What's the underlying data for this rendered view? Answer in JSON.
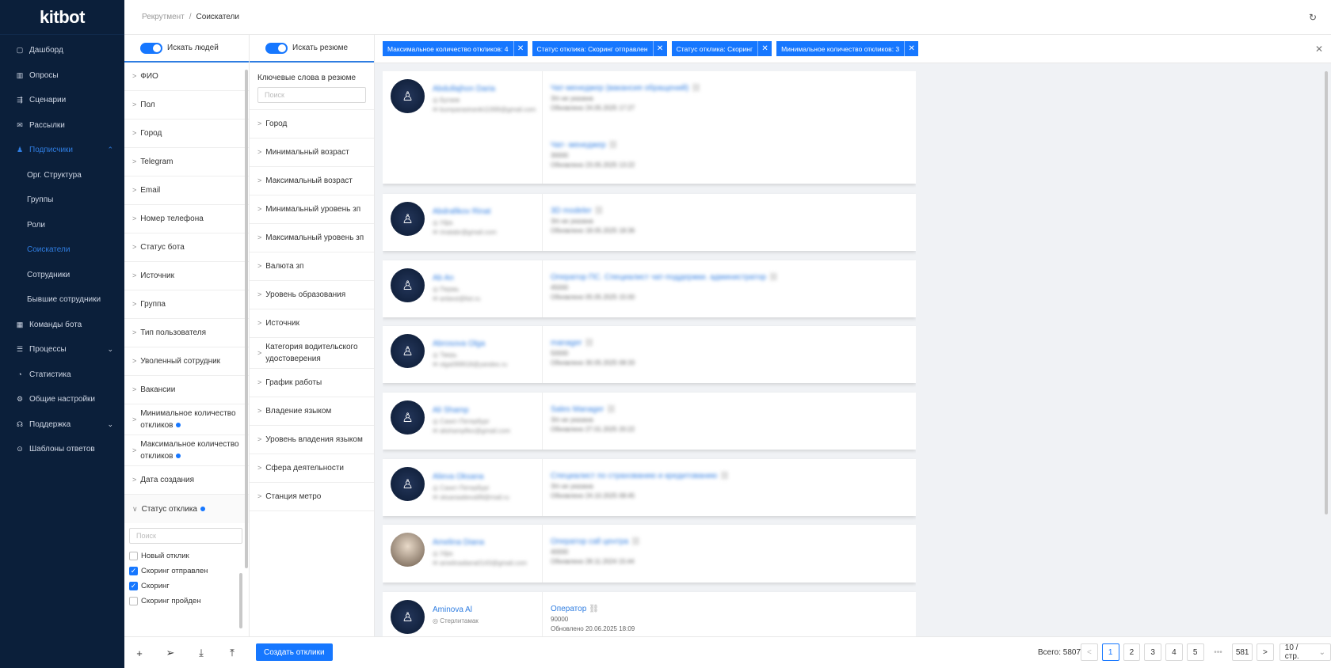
{
  "sidebar": {
    "logo": "kitbot",
    "items": [
      {
        "label": "Дашборд",
        "icon": "dashboard-icon",
        "glyph": "▢"
      },
      {
        "label": "Опросы",
        "icon": "chart-icon",
        "glyph": "▥"
      },
      {
        "label": "Сценарии",
        "icon": "scenario-icon",
        "glyph": "⇶"
      },
      {
        "label": "Рассылки",
        "icon": "mail-icon",
        "glyph": "✉"
      },
      {
        "label": "Подписчики",
        "icon": "users-icon",
        "glyph": "♟",
        "chevron": "⌃"
      },
      {
        "label": "Орг. Структура",
        "sub": true
      },
      {
        "label": "Группы",
        "sub": true
      },
      {
        "label": "Роли",
        "sub": true
      },
      {
        "label": "Соискатели",
        "sub": true
      },
      {
        "label": "Сотрудники",
        "sub": true
      },
      {
        "label": "Бывшие сотрудники",
        "sub": true
      },
      {
        "label": "Команды бота",
        "icon": "grid-icon",
        "glyph": "▦"
      },
      {
        "label": "Процессы",
        "icon": "list-icon",
        "glyph": "☰",
        "chevron": "⌄"
      },
      {
        "label": "Статистика",
        "icon": "pie-icon",
        "glyph": "◔"
      },
      {
        "label": "Общие настройки",
        "icon": "gear-icon",
        "glyph": "⚙"
      },
      {
        "label": "Поддержка",
        "icon": "headset-icon",
        "glyph": "☊",
        "chevron": "⌄"
      },
      {
        "label": "Шаблоны ответов",
        "icon": "template-icon",
        "glyph": "⊙"
      }
    ]
  },
  "header": {
    "crumb_prev": "Рекрутмент",
    "crumb_sep": "/",
    "crumb_cur": "Соискатели",
    "refresh_glyph": "↻"
  },
  "filters_people": {
    "toggle_label": "Искать людей",
    "arrow": ">",
    "dot_active": true,
    "items": [
      {
        "label": "ФИО"
      },
      {
        "label": "Пол"
      },
      {
        "label": "Город"
      },
      {
        "label": "Telegram"
      },
      {
        "label": "Email"
      },
      {
        "label": "Номер телефона"
      },
      {
        "label": "Статус бота"
      },
      {
        "label": "Источник"
      },
      {
        "label": "Группа"
      },
      {
        "label": "Тип пользователя"
      },
      {
        "label": "Уволенный сотрудник"
      },
      {
        "label": "Вакансии"
      },
      {
        "label": "Минимальное количество откликов",
        "dot": true
      },
      {
        "label": "Максимальное количество откликов",
        "dot": true
      },
      {
        "label": "Дата создания"
      }
    ],
    "status_section": {
      "label": "Статус отклика",
      "arrow": "∨",
      "search_placeholder": "Поиск",
      "options": [
        {
          "label": "Новый отклик",
          "checked": false
        },
        {
          "label": "Скоринг отправлен",
          "checked": true
        },
        {
          "label": "Скоринг",
          "checked": true
        },
        {
          "label": "Скоринг пройден",
          "checked": false
        }
      ]
    }
  },
  "filters_resume": {
    "toggle_label": "Искать резюме",
    "keywords_label": "Ключевые слова в резюме",
    "keywords_placeholder": "Поиск",
    "items": [
      {
        "label": "Город"
      },
      {
        "label": "Минимальный возраст"
      },
      {
        "label": "Максимальный возраст"
      },
      {
        "label": "Минимальный уровень зп"
      },
      {
        "label": "Максимальный уровень зп"
      },
      {
        "label": "Валюта зп"
      },
      {
        "label": "Уровень образования"
      },
      {
        "label": "Источник"
      },
      {
        "label": "Категория водительского удостоверения"
      },
      {
        "label": "График работы"
      },
      {
        "label": "Владение языком"
      },
      {
        "label": "Уровень владения языком"
      },
      {
        "label": "Сфера деятельности"
      },
      {
        "label": "Станция метро"
      }
    ]
  },
  "tags": [
    {
      "label": "Максимальное количество откликов: 4",
      "close": "✕"
    },
    {
      "label": "Статус отклика: Скоринг отправлен",
      "close": "✕"
    },
    {
      "label": "Статус отклика: Скоринг",
      "close": "✕"
    },
    {
      "label": "Минимальное количество откликов: 3",
      "close": "✕"
    }
  ],
  "tagbar_close": "✕",
  "cards": [
    {
      "name": "Abdullajhon Daria",
      "city": "Бугаев",
      "email": "bumparastranik11999@gmail.com",
      "vacancies": [
        {
          "title": "Чат-менеджер (вакансия обращений)",
          "salary": "З/п не указана",
          "updated": "Обновлено 24.05.2025 17:27"
        },
        {
          "title": "Чат- менеджер",
          "salary": "30000",
          "updated": "Обновлено 23.05.2025 13:22"
        }
      ]
    },
    {
      "name": "Abdrafikov Rinat",
      "city": "Уфа",
      "email": "rinatabr@gmail.com",
      "vacancies": [
        {
          "title": "3D modeler",
          "salary": "З/п не указана",
          "updated": "Обновлено 18.05.2025 18:36"
        }
      ]
    },
    {
      "name": "Ab An",
      "city": "Пермь",
      "email": "anbest@list.ru",
      "vacancies": [
        {
          "title": "Оператор ПС. Специалист чат-поддержки. администратор",
          "salary": "45000",
          "updated": "Обновлено 05.05.2025 15:00"
        }
      ]
    },
    {
      "name": "Abrosova Olga",
      "city": "Тверь",
      "email": "olga099918@yandex.ru",
      "vacancies": [
        {
          "title": "manager",
          "salary": "50000",
          "updated": "Обновлено 30.05.2025 08:33"
        }
      ]
    },
    {
      "name": "Ali Shamp",
      "city": "Санкт-Петербург",
      "email": "alishampflex@gmail.com",
      "vacancies": [
        {
          "title": "Sales Manager",
          "salary": "З/п не указана",
          "updated": "Обновлено 27.01.2025 20:22"
        }
      ]
    },
    {
      "name": "Alieva Oksana",
      "city": "Санкт-Петербург",
      "email": "oksanaalieva99@mail.ru",
      "vacancies": [
        {
          "title": "Специалист по страхованию и кредитованию",
          "salary": "З/п не указана",
          "updated": "Обновлено 24.10.2025 08:45"
        }
      ]
    },
    {
      "name": "Amelina Diana",
      "city": "Уфа",
      "email": "amelinadiana0143@gmail.com",
      "photo": true,
      "vacancies": [
        {
          "title": "Оператор call центра",
          "salary": "40000",
          "updated": "Обновлено 28.11.2024 15:44"
        }
      ]
    },
    {
      "name": "Aminova Al",
      "city": "Стерлитамак",
      "email": "",
      "clear": true,
      "vacancies": [
        {
          "title": "Оператор",
          "salary": "90000",
          "updated": "Обновлено 20.06.2025 18:09"
        }
      ]
    }
  ],
  "footer": {
    "create_label": "Создать отклики",
    "total_label": "Всего: 5807",
    "pages": [
      "1",
      "2",
      "3",
      "4",
      "5",
      "•••",
      "581"
    ],
    "current_page": "1",
    "page_size": "10 / стр.",
    "prev_glyph": "<",
    "next_glyph": ">",
    "add_glyph": "+",
    "send_glyph": "➢",
    "download_glyph": "⤓",
    "upload_glyph": "⤒",
    "pagesize_chevron": "⌄"
  },
  "colors": {
    "primary": "#1677ff",
    "sidebar_bg": "#0b1f3a",
    "active_link": "#2f7de1"
  }
}
